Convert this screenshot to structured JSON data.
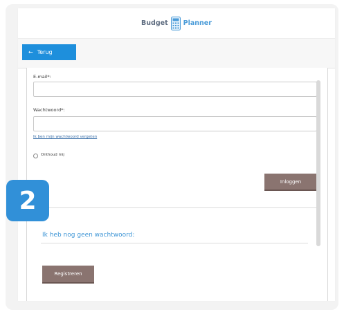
{
  "header": {
    "logo_word_1": "Budget",
    "logo_word_2": "Planner"
  },
  "toolbar": {
    "back_label": "Terug"
  },
  "form": {
    "email_label": "E-mail*:",
    "email_value": "",
    "password_label": "Wachtwoord*:",
    "password_value": "",
    "forgot_link": "Ik ben mijn wachtwoord vergeten",
    "remember_label": "Onthoud mij",
    "login_button": "Inloggen"
  },
  "register": {
    "title": "Ik heb nog geen wachtwoord:",
    "button": "Registreren"
  },
  "badge": {
    "step": "2"
  },
  "colors": {
    "accent_blue": "#1e8fdc",
    "button_brown": "#8a7470",
    "title_blue": "#3f96d6"
  }
}
